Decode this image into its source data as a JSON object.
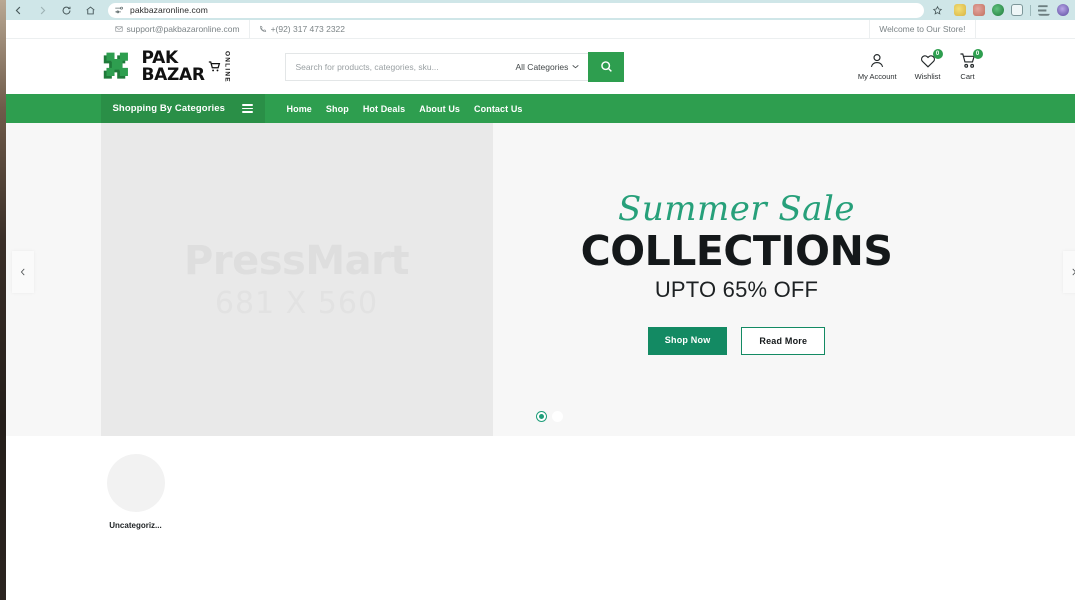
{
  "browser": {
    "url": "pakbazaronline.com",
    "back_icon": "back-arrow-icon",
    "forward_icon": "forward-arrow-icon",
    "reload_icon": "reload-icon",
    "home_icon": "home-icon",
    "tune_icon": "site-settings-icon",
    "star_icon": "bookmark-star-icon",
    "extensions": [
      "extension-icon-1",
      "extension-icon-2",
      "extension-icon-3",
      "extension-icon-4",
      "reading-list-icon",
      "profile-avatar-icon"
    ]
  },
  "topbar": {
    "email": "support@pakbazaronline.com",
    "phone": "+(92) 317 473 2322",
    "welcome": "Welcome to Our Store!",
    "email_icon": "envelope-icon",
    "phone_icon": "phone-icon"
  },
  "logo": {
    "pak": "PAK",
    "bazar": "BAZAR",
    "online": "ONLINE"
  },
  "search": {
    "placeholder": "Search for products, categories, sku...",
    "value": "",
    "category": "All Categories",
    "button_icon": "search-icon"
  },
  "actions": [
    {
      "label": "My Account",
      "icon": "user-icon",
      "badge": null
    },
    {
      "label": "Wishlist",
      "icon": "heart-icon",
      "badge": "0"
    },
    {
      "label": "Cart",
      "icon": "cart-icon",
      "badge": "0"
    }
  ],
  "nav": {
    "categories_label": "Shopping By Categories",
    "menu": [
      "Home",
      "Shop",
      "Hot Deals",
      "About Us",
      "Contact Us"
    ]
  },
  "hero": {
    "placeholder_name": "PressMart",
    "placeholder_dim": "681 X 560",
    "script": "Summer Sale",
    "headline": "COLLECTIONS",
    "subline": "UPTO 65% OFF",
    "primary_btn": "Shop Now",
    "secondary_btn": "Read More",
    "slide_count": 2,
    "active_slide": 1,
    "prev_icon": "chevron-left-icon",
    "next_icon": "chevron-right-icon"
  },
  "categories": [
    {
      "name": "Uncategoriz..."
    }
  ],
  "colors": {
    "brand_green": "#2e9e4f",
    "accent_teal": "#138a63",
    "script_green": "#27a07a",
    "browser_bar": "#cfe6e8"
  }
}
